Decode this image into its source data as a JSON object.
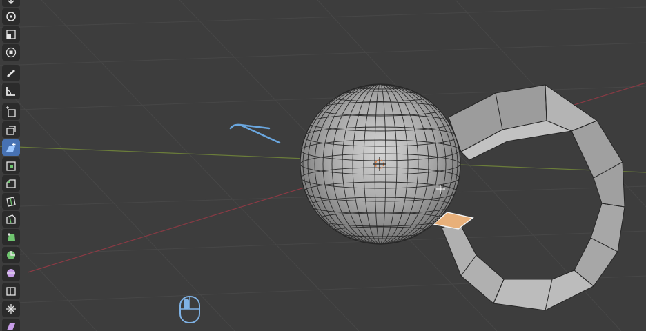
{
  "app": {
    "editor": "3D Viewport"
  },
  "colors": {
    "background": "#3d3d3d",
    "grid_line": "#474747",
    "x_axis": "#8a3a44",
    "y_axis": "#6b7d3a",
    "mesh_face": "#a9a9a9",
    "mesh_edge": "#262626",
    "selection": "#e8b07a",
    "active_tool": "#4772b3",
    "toolbar_button": "#2b2b2b",
    "annotation": "#6aa6de"
  },
  "toolbar": {
    "tools": [
      {
        "name": "move",
        "icon": "move-arrows-icon"
      },
      {
        "name": "rotate",
        "icon": "rotate-icon"
      },
      {
        "name": "scale",
        "icon": "scale-icon"
      },
      {
        "name": "transform",
        "icon": "transform-icon"
      },
      {
        "name": "annotate",
        "icon": "annotate-pencil-icon"
      },
      {
        "name": "measure",
        "icon": "measure-ruler-icon"
      },
      {
        "name": "add-cube",
        "icon": "add-cube-icon"
      },
      {
        "name": "extrude-region",
        "icon": "extrude-region-icon"
      },
      {
        "name": "extrude-manifold",
        "icon": "extrude-manifold-icon",
        "active": true
      },
      {
        "name": "inset-faces",
        "icon": "inset-faces-icon"
      },
      {
        "name": "bevel",
        "icon": "bevel-icon"
      },
      {
        "name": "loop-cut",
        "icon": "loop-cut-icon"
      },
      {
        "name": "knife",
        "icon": "knife-icon"
      },
      {
        "name": "poly-build",
        "icon": "poly-build-icon"
      },
      {
        "name": "spin",
        "icon": "spin-icon"
      },
      {
        "name": "smooth",
        "icon": "smooth-sphere-icon"
      },
      {
        "name": "edge-slide",
        "icon": "edge-slide-icon"
      },
      {
        "name": "shrink-fatten",
        "icon": "shrink-fatten-icon"
      },
      {
        "name": "shear",
        "icon": "shear-icon"
      }
    ]
  },
  "status": {
    "mouse_button": "left"
  }
}
